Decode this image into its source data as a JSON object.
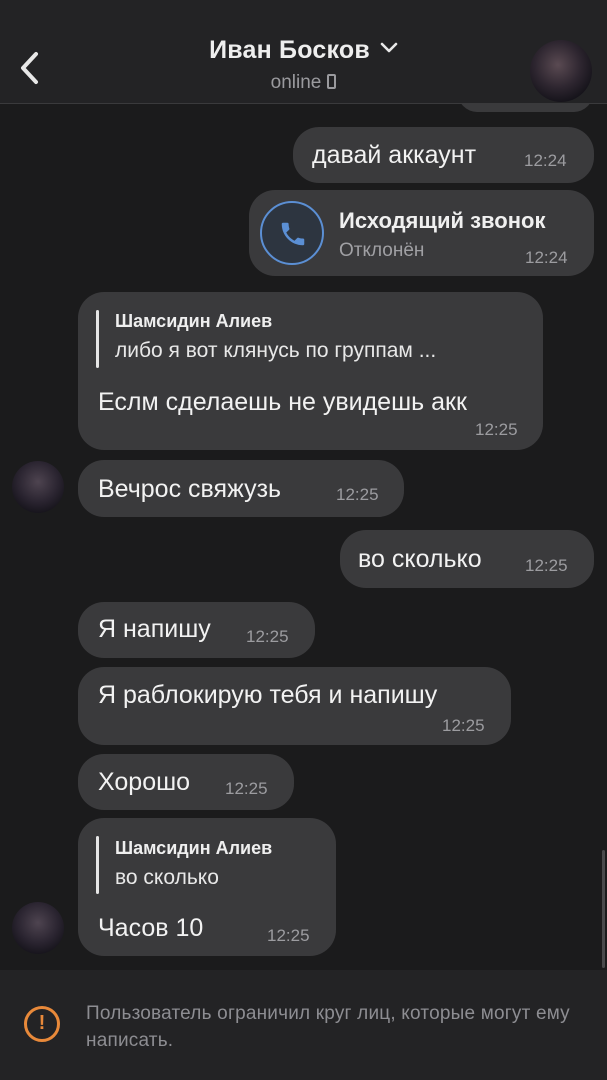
{
  "header": {
    "title": "Иван Босков",
    "subtitle": "online"
  },
  "messages": [
    {
      "direction": "outgoing",
      "text": "давай аккаунт",
      "time": "12:24"
    },
    {
      "direction": "outgoing",
      "type": "call",
      "title": "Исходящий звонок",
      "status": "Отклонён",
      "time": "12:24"
    },
    {
      "direction": "incoming",
      "reply_author": "Шамсидин Алиев",
      "reply_text": "либо я вот клянусь по группам ...",
      "text": "Еслм сделаешь не увидешь акк",
      "time": "12:25"
    },
    {
      "direction": "incoming",
      "text": "Вечрос свяжузь",
      "time": "12:25"
    },
    {
      "direction": "outgoing",
      "text": "во сколько",
      "time": "12:25"
    },
    {
      "direction": "incoming",
      "text": "Я напишу",
      "time": "12:25"
    },
    {
      "direction": "incoming",
      "text": "Я раблокирую тебя и напишу",
      "time": "12:25"
    },
    {
      "direction": "incoming",
      "text": "Хорошо",
      "time": "12:25"
    },
    {
      "direction": "incoming",
      "reply_author": "Шамсидин Алиев",
      "reply_text": "во сколько",
      "text": "Часов 10",
      "time": "12:25"
    }
  ],
  "notice": {
    "text": "Пользователь ограничил круг лиц, которые могут ему написать."
  },
  "colors": {
    "background": "#1b1b1c",
    "bubble": "#3a3a3c",
    "call_accent": "#5b8fd4",
    "warning": "#e8893a"
  }
}
